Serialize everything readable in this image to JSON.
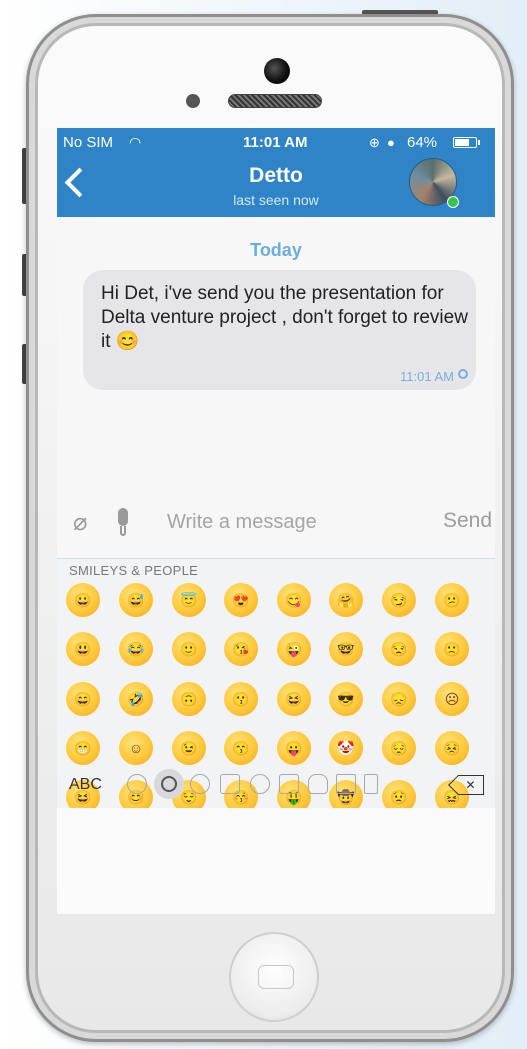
{
  "status_bar": {
    "carrier": "No SIM",
    "time": "11:01 AM",
    "battery": "64%"
  },
  "header": {
    "contact_name": "Detto",
    "last_seen": "last seen now"
  },
  "chat": {
    "date_label": "Today",
    "message": {
      "text": "Hi Det, i've send you the presentation for Delta venture project , don't forget to review it 😊",
      "time": "11:01 AM"
    }
  },
  "composer": {
    "placeholder": "Write a message",
    "send_label": "Send"
  },
  "keyboard": {
    "section_title": "SMILEYS & PEOPLE",
    "abc_label": "ABC",
    "emoji_rows": [
      [
        "😀",
        "😅",
        "😇",
        "😍",
        "😋",
        "🤗",
        "😏",
        "😕"
      ],
      [
        "😃",
        "😂",
        "🙂",
        "😘",
        "😜",
        "🤓",
        "😒",
        "🙁"
      ],
      [
        "😄",
        "🤣",
        "🙃",
        "😗",
        "😆",
        "😎",
        "😞",
        "☹"
      ],
      [
        "😁",
        "☺",
        "😉",
        "😙",
        "😛",
        "🤡",
        "😔",
        "😣"
      ],
      [
        "😆",
        "😊",
        "😌",
        "😚",
        "🤑",
        "🤠",
        "😟",
        "😖"
      ]
    ],
    "categories": [
      "recent-icon",
      "smileys-icon",
      "animals-icon",
      "food-icon",
      "sports-icon",
      "travel-icon",
      "objects-icon",
      "symbols-icon",
      "flags-icon"
    ],
    "selected_category": "smileys-icon"
  }
}
